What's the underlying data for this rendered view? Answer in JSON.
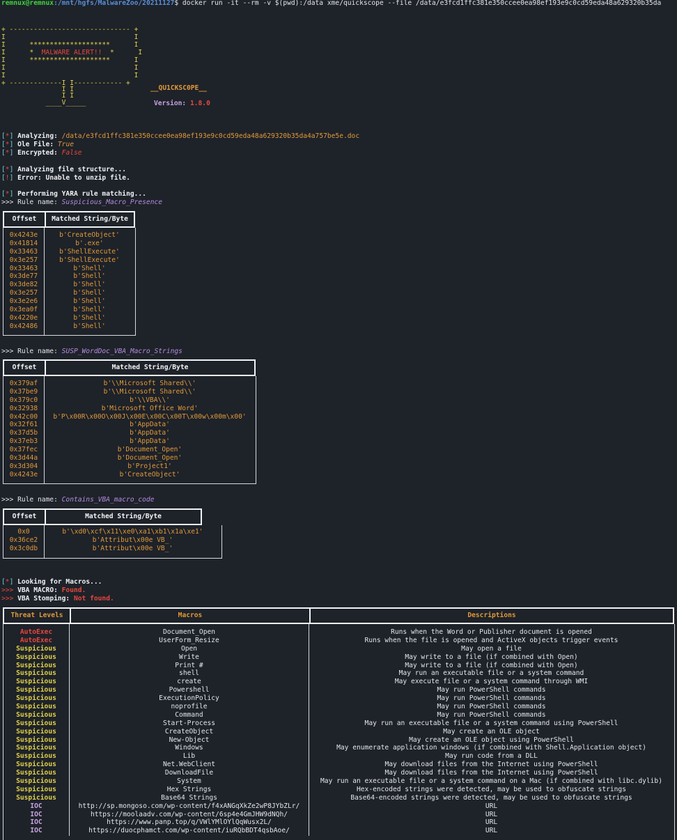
{
  "prompt": {
    "user": "remnux@remnux",
    "path": ":/mnt/hgfs/MalwareZoo/20211127",
    "command": "$ docker run -it --rm -v $(pwd):/data xme/quickscope --file /data/e3fcd1ffc381e350ccee0ea98ef193e9c0cd59eda48a629320b35da"
  },
  "banner": {
    "l1": "+ ------------------------------ +",
    "l2": "I                                I",
    "l3": "I      ********************      I",
    "l4a": "I      *  ",
    "alert": "MALWARE ALERT!!",
    "l4b": "  *      I",
    "l5": "I      ********************      I",
    "l6": "I                                I",
    "l7": "I                                I",
    "l8": "+ -------------I I------------ +",
    "l9": "               I I",
    "l10": "               I I",
    "l11": "           ____V_____",
    "name": "__QU1CKSC0PE__",
    "version_label": "Version: ",
    "version": "1.8.0"
  },
  "analysis": {
    "analyzing_label": "Analyzing: ",
    "analyzing_file": "/data/e3fcd1ffc381e350ccee0ea98ef193e9c0cd59eda48a629320b35da4a757be5e.doc",
    "ole_label": "Ole File: ",
    "ole_value": "True",
    "enc_label": "Encrypted: ",
    "enc_value": "False",
    "structure": "Analyzing file structure...",
    "error": "Error: Unable to unzip file.",
    "yara": "Performing YARA rule matching...",
    "rule_prefix": ">>> Rule name: ",
    "star": "*",
    "bang": "!"
  },
  "rules": [
    {
      "name": "Suspicious_Macro_Presence",
      "headers": [
        "Offset",
        "Matched String/Byte"
      ],
      "offsets": [
        "0x4243e",
        "0x41814",
        "0x33463",
        "0x3e257",
        "0x33463",
        "0x3de77",
        "0x3de82",
        "0x3e257",
        "0x3e2e6",
        "0x3ea0f",
        "0x4220e",
        "0x42486"
      ],
      "strings": [
        "b'CreateObject'",
        "b'.exe'",
        "b'ShellExecute'",
        "b'ShellExecute'",
        "b'Shell'",
        "b'Shell'",
        "b'Shell'",
        "b'Shell'",
        "b'Shell'",
        "b'Shell'",
        "b'Shell'",
        "b'Shell'"
      ]
    },
    {
      "name": "SUSP_WordDoc_VBA_Macro_Strings",
      "headers": [
        "Offset",
        "Matched String/Byte"
      ],
      "offsets": [
        "0x379af",
        "0x37be9",
        "0x379c0",
        "0x32938",
        "0x42c00",
        "0x32f61",
        "0x37d5b",
        "0x37eb3",
        "0x37fec",
        "0x3d44a",
        "0x3d304",
        "0x4243e"
      ],
      "strings": [
        "b'\\\\Microsoft Shared\\\\'",
        "b'\\\\Microsoft Shared\\\\'",
        "b'\\\\VBA\\\\'",
        "b'Microsoft Office Word'",
        "b'P\\x00R\\x00O\\x00J\\x00E\\x00C\\x00T\\x00w\\x00m\\x00'",
        "b'AppData'",
        "b'AppData'",
        "b'AppData'",
        "b'Document_Open'",
        "b'Document_Open'",
        "b'Project1'",
        "b'CreateObject'"
      ]
    },
    {
      "name": "Contains_VBA_macro_code",
      "headers": [
        "Offset",
        "Matched String/Byte"
      ],
      "offsets": [
        "0x0",
        "0x36ce2",
        "0x3c0db"
      ],
      "strings": [
        "b'\\xd0\\xcf\\x11\\xe0\\xa1\\xb1\\x1a\\xe1'",
        "b'Attribut\\x00e VB_'",
        "b'Attribut\\x00e VB_'"
      ]
    }
  ],
  "macros": {
    "looking": "Looking for Macros...",
    "arrow": ">>> ",
    "vba_label": "VBA MACRO: ",
    "vba_value": "Found.",
    "stomp_label": "VBA Stomping: ",
    "stomp_value": "Not found.",
    "headers": [
      "Threat Levels",
      "Macros",
      "Descriptions"
    ],
    "levels": [
      "AutoExec",
      "AutoExec",
      "Suspicious",
      "Suspicious",
      "Suspicious",
      "Suspicious",
      "Suspicious",
      "Suspicious",
      "Suspicious",
      "Suspicious",
      "Suspicious",
      "Suspicious",
      "Suspicious",
      "Suspicious",
      "Suspicious",
      "Suspicious",
      "Suspicious",
      "Suspicious",
      "Suspicious",
      "Suspicious",
      "Suspicious",
      "IOC",
      "IOC",
      "IOC",
      "IOC"
    ],
    "names": [
      "Document_Open",
      "UserForm_Resize",
      "Open",
      "Write",
      "Print #",
      "shell",
      "create",
      "Powershell",
      "ExecutionPolicy",
      "noprofile",
      "Command",
      "Start-Process",
      "CreateObject",
      "New-Object",
      "Windows",
      "Lib",
      "Net.WebClient",
      "DownloadFile",
      "System",
      "Hex Strings",
      "Base64 Strings",
      "http://sp.mongoso.com/wp-content/f4xANGqXkZe2wP8JYbZLr/",
      "https://moolaadv.com/wp-content/6sp4e4GmJHW9dNQh/",
      "https://www.panp.top/q/VWlYMlOYlQqWusx2L/",
      "https://duocphamct.com/wp-content/iuRQbBDT4qsbAoe/"
    ],
    "descriptions": [
      "Runs when the Word or Publisher document is opened",
      "Runs when the file is opened and ActiveX objects trigger events",
      "May open a file",
      "May write to a file (if combined with Open)",
      "May write to a file (if combined with Open)",
      "May run an executable file or a system command",
      "May execute file or a system command through WMI",
      "May run PowerShell commands",
      "May run PowerShell commands",
      "May run PowerShell commands",
      "May run PowerShell commands",
      "May run an executable file or a system command using PowerShell",
      "May create an OLE object",
      "May create an OLE object using PowerShell",
      "May enumerate application windows (if combined with Shell.Application object)",
      "May run code from a DLL",
      "May download files from the Internet using PowerShell",
      "May download files from the Internet using PowerShell",
      "May run an executable file or a system command on a Mac (if combined with libc.dylib)",
      "Hex-encoded strings were detected, may be used to obfuscate strings",
      "Base64-encoded strings were detected, may be used to obfuscate strings",
      "URL",
      "URL",
      "URL",
      "URL"
    ]
  }
}
